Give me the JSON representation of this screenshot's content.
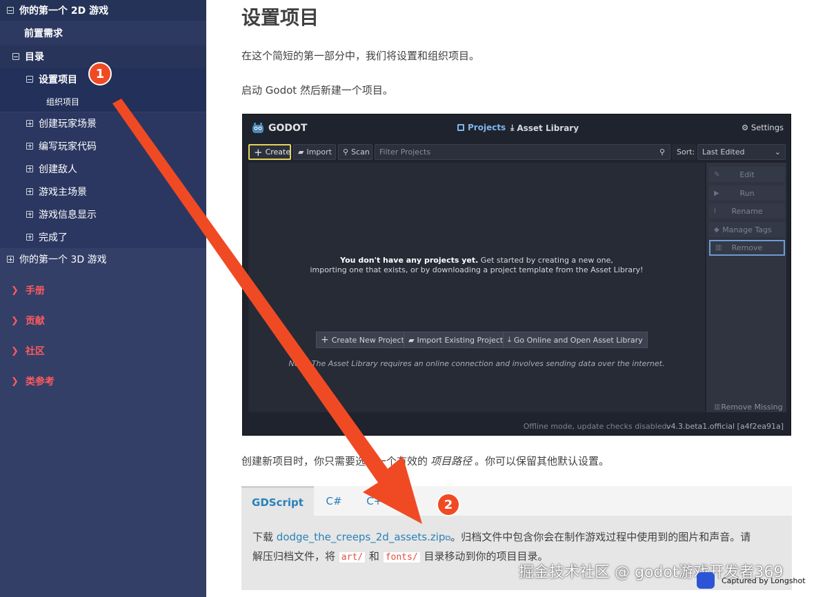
{
  "sidebar": {
    "items": [
      {
        "label": "你的第一个 2D 游戏",
        "toggle": "minus"
      },
      {
        "label": "前置需求"
      },
      {
        "label": "目录",
        "toggle": "minus"
      },
      {
        "label": "设置项目",
        "toggle": "minus"
      },
      {
        "label": "组织项目"
      },
      {
        "label": "创建玩家场景",
        "toggle": "plus"
      },
      {
        "label": "编写玩家代码",
        "toggle": "plus"
      },
      {
        "label": "创建敌人",
        "toggle": "plus"
      },
      {
        "label": "游戏主场景",
        "toggle": "plus"
      },
      {
        "label": "游戏信息显示",
        "toggle": "plus"
      },
      {
        "label": "完成了",
        "toggle": "plus"
      },
      {
        "label": "你的第一个 3D 游戏",
        "toggle": "plus"
      }
    ],
    "sections": [
      "手册",
      "贡献",
      "社区",
      "类参考"
    ]
  },
  "content": {
    "title": "设置项目",
    "p1": "在这个简短的第一部分中，我们将设置和组织项目。",
    "p2": "启动 Godot 然后新建一个项目。",
    "p3_a": "创建新项目时，你只需要选择一个有效的",
    "p3_em": "项目路径",
    "p3_b": "。你可以保留其他默认设置。",
    "tabs": [
      "GDScript",
      "C#",
      "C++"
    ],
    "download_pre": "下载",
    "download_link": "dodge_the_creeps_2d_assets.zip",
    "download_post": "。归档文件中包含你会在制作游戏过程中使用到的图片和声音。请",
    "line2_pre": "解压归档文件，将",
    "code1": "art/",
    "line2_and": "和",
    "code2": "fonts/",
    "line2_post": "目录移动到你的项目目录。"
  },
  "godot": {
    "logo": "GODOT",
    "tab_projects": "Projects",
    "tab_asset": "Asset Library",
    "settings": "Settings",
    "create": "Create",
    "import": "Import",
    "scan": "Scan",
    "filter_placeholder": "Filter Projects",
    "sort_label": "Sort:",
    "sort_value": "Last Edited",
    "side_buttons": [
      "Edit",
      "Run",
      "Rename",
      "Manage Tags",
      "Remove"
    ],
    "remove_missing": "Remove Missing",
    "empty_bold": "You don't have any projects yet.",
    "empty_rest": " Get started by creating a new one,",
    "empty_line2": "importing one that exists, or by downloading a project template from the Asset Library!",
    "btn_new": "Create New Project",
    "btn_import": "Import Existing Project",
    "btn_online": "Go Online and Open Asset Library",
    "note": "Note: The Asset Library requires an online connection and involves sending data over the internet.",
    "status_offline": "Offline mode, update checks disabled.",
    "version": "v4.3.beta1.official [a4f2ea91a]"
  },
  "annotations": {
    "badge1": "1",
    "badge2": "2"
  },
  "watermark": {
    "text": "掘金技术社区 @ godot游戏开发者369",
    "capture": "Captured by Longshot"
  },
  "colors": {
    "sidebar_bg": "#333f67",
    "accent_red": "#fd5a5f",
    "link": "#2980b9",
    "arrow": "#f04a24"
  }
}
